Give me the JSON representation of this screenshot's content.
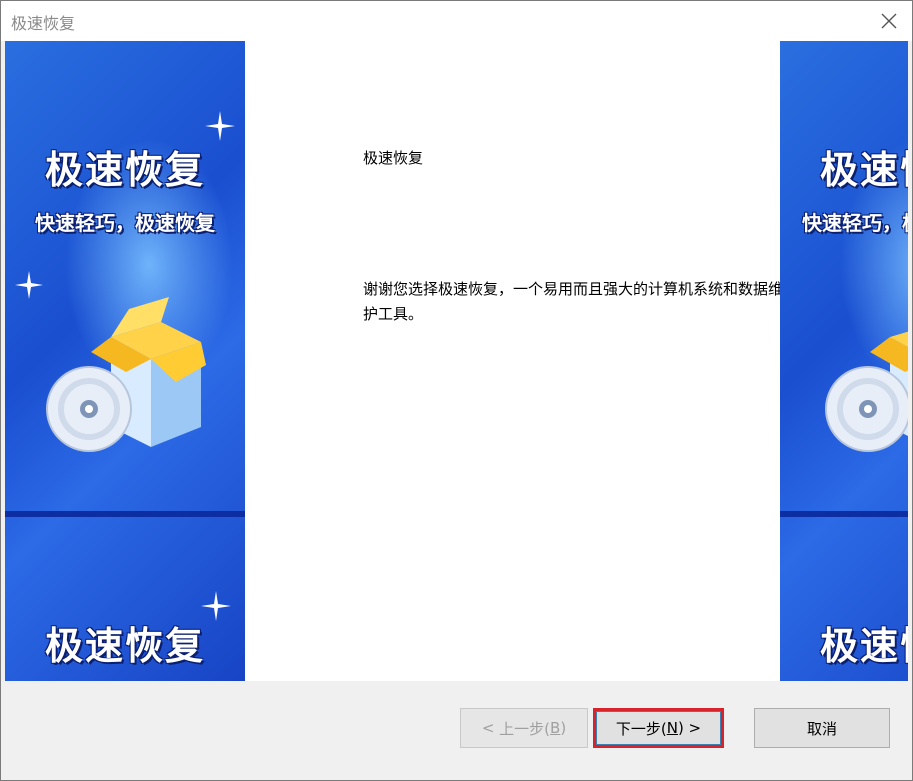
{
  "window": {
    "title": "极速恢复"
  },
  "side_panel": {
    "title": "极速恢复",
    "slogan": "快速轻巧，极速恢复",
    "bottom_title": "极速恢复",
    "colors": {
      "primary": "#1a4fd0",
      "light": "#7ec0ff",
      "dark": "#0d2ea3"
    }
  },
  "main": {
    "heading": "极速恢复",
    "body": "谢谢您选择极速恢复，一个易用而且强大的计算机系统和数据维护工具。"
  },
  "buttons": {
    "back": {
      "prefix": "< ",
      "label": "上一步(",
      "mnemonic": "B",
      "suffix": ")"
    },
    "next": {
      "label": "下一步(",
      "mnemonic": "N",
      "suffix": ") >"
    },
    "cancel": "取消"
  },
  "accent_colors": {
    "highlight": "#d9232a"
  }
}
